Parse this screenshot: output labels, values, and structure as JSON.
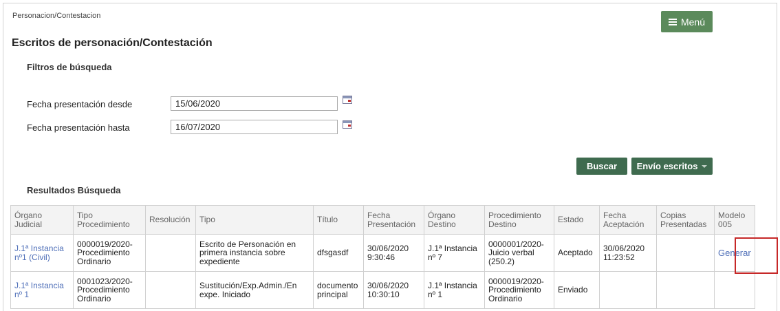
{
  "breadcrumb": "Personacion/Contestacion",
  "menu_label": "Menú",
  "page_title": "Escritos de personación/Contestación",
  "filters": {
    "title": "Filtros de búsqueda",
    "date_from_label": "Fecha presentación desde",
    "date_from_value": "15/06/2020",
    "date_to_label": "Fecha presentación hasta",
    "date_to_value": "16/07/2020"
  },
  "buttons": {
    "search": "Buscar",
    "send": "Envío escritos"
  },
  "results": {
    "title": "Resultados Búsqueda",
    "headers": {
      "organo": "Órgano Judicial",
      "tipo_proc": "Tipo Procedimiento",
      "resolucion": "Resolución",
      "tipo": "Tipo",
      "titulo": "Título",
      "fecha_pres": "Fecha Presentación",
      "organo_dest": "Órgano Destino",
      "proc_dest": "Procedimiento Destino",
      "estado": "Estado",
      "fecha_acep": "Fecha Aceptación",
      "copias": "Copias Presentadas",
      "modelo": "Modelo 005"
    },
    "rows": [
      {
        "organo": "J.1ª Instancia nº1 (Civil)",
        "tipo_proc": "0000019/2020-Procedimiento Ordinario",
        "resolucion": "",
        "tipo": "Escrito de Personación en primera instancia sobre expediente",
        "titulo": "dfsgasdf",
        "fecha_pres": "30/06/2020 9:30:46",
        "organo_dest": "J.1ª Instancia nº 7",
        "proc_dest": "0000001/2020-Juicio verbal (250.2)",
        "estado": "Aceptado",
        "fecha_acep": "30/06/2020 11:23:52",
        "copias": "",
        "modelo": "Generar"
      },
      {
        "organo": "J.1ª Instancia nº 1",
        "tipo_proc": "0001023/2020-Procedimiento Ordinario",
        "resolucion": "",
        "tipo": "Sustitución/Exp.Admin./En expe. Iniciado",
        "titulo": "documento principal",
        "fecha_pres": "30/06/2020 10:30:10",
        "organo_dest": "J.1ª Instancia nº 1",
        "proc_dest": "0000019/2020-Procedimiento Ordinario",
        "estado": "Enviado",
        "fecha_acep": "",
        "copias": "",
        "modelo": ""
      }
    ]
  },
  "colors": {
    "menu_button": "#5b8a5b",
    "action_button": "#3f6b4f",
    "link": "#4f6fb8",
    "highlight": "#c62828"
  },
  "icons": [
    "menu-icon",
    "calendar-icon",
    "chevron-down-icon"
  ]
}
